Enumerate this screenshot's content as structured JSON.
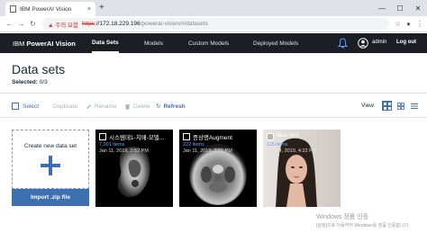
{
  "browser": {
    "tab_title": "IBM PowerAI Vision",
    "tab_close": "×",
    "new_tab": "+",
    "warning": "▲ 주의 요함",
    "url_scheme": "https",
    "url_host": "://172.18.229.196",
    "url_path": "/powerai-vision/#/datasets",
    "window_minimize": "—",
    "window_maximize": "☐",
    "window_close": "✕"
  },
  "nav": {
    "brand_prefix": "IBM ",
    "brand_bold": "PowerAI Vision",
    "items": [
      "Data Sets",
      "Models",
      "Custom Models",
      "Deployed Models"
    ],
    "active_index": 0,
    "user": "admin",
    "logout": "Log out"
  },
  "page": {
    "title": "Data sets",
    "selected_label": "Selected:",
    "selected_value": "0/3"
  },
  "toolbar": {
    "select": "Select",
    "duplicate": "Duplicate",
    "rename": "Rename",
    "delete": "Delete",
    "refresh": "Refresh",
    "view_label": "View:",
    "view_mode": "grid"
  },
  "create": {
    "label": "Create new data set",
    "import": "Import .zip file"
  },
  "datasets": [
    {
      "name": "시스템데1-치매-모델...",
      "count": "7,001 items",
      "date": "Jan 11, 2019, 2:52 PM"
    },
    {
      "name": "증상명Augment",
      "count": "222 items",
      "date": "Jan 11, 2019, 2:51 PM"
    },
    {
      "name": "face test",
      "count": "115 items",
      "date": "Jan 14, 2019, 4:22 PM"
    }
  ],
  "watermark": {
    "line1": "Windows 정품 인증",
    "line2": "[설정]으로 이동하여 Windows를 정품 인증합니다."
  },
  "colors": {
    "nav_bg": "#1b1f24",
    "accent": "#3d70b2",
    "disabled": "#a8b4bf"
  }
}
